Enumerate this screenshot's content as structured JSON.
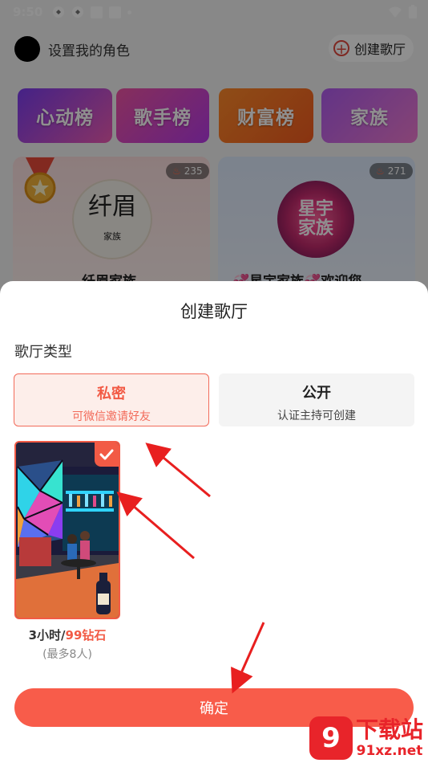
{
  "status_bar": {
    "time": "9:50"
  },
  "header": {
    "set_role": "设置我的角色",
    "create_room": "创建歌厅"
  },
  "banners": [
    "心动榜",
    "歌手榜",
    "财富榜",
    "家族"
  ],
  "families": [
    {
      "name": "纤眉家族",
      "heat": "235",
      "logo_text": "纤眉",
      "logo_sub": "家族"
    },
    {
      "name": "💞星宇家族💞欢迎您",
      "heat": "271",
      "logo_text": "星宇家族"
    }
  ],
  "sheet": {
    "title": "创建歌厅",
    "type_label": "歌厅类型",
    "types": [
      {
        "name": "私密",
        "desc": "可微信邀请好友"
      },
      {
        "name": "公开",
        "desc": "认证主持可创建"
      }
    ],
    "theme": {
      "duration": "3小时/",
      "price": "99钻石",
      "capacity": "(最多8人)"
    },
    "confirm": "确定"
  },
  "watermark": {
    "logo": "9",
    "title": "下载站",
    "url": "91xz.net"
  },
  "colors": {
    "accent": "#f85c4a",
    "private_bg": "#fdeeea"
  }
}
